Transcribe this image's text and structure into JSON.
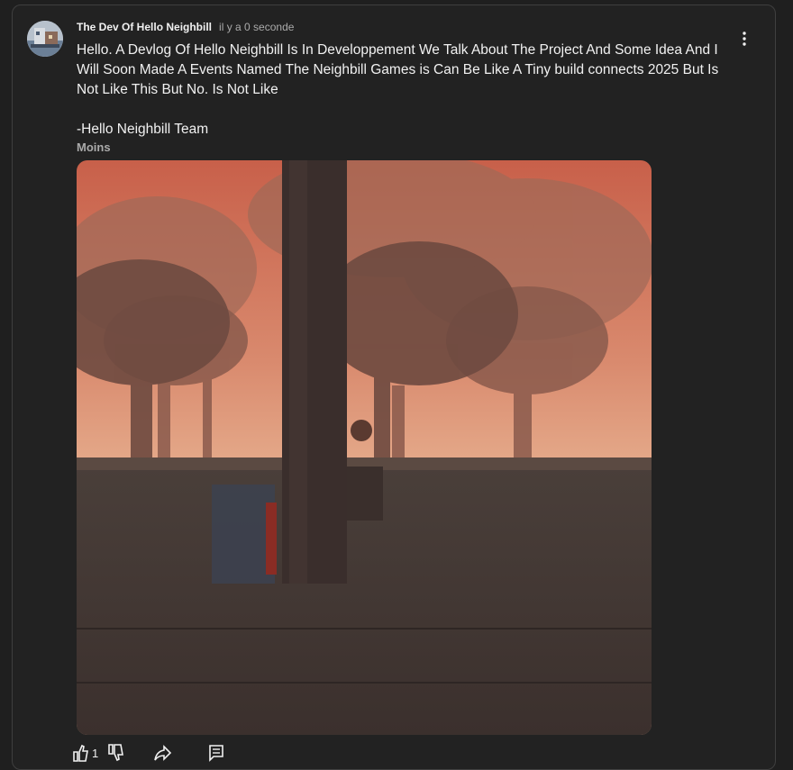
{
  "post": {
    "channel_name": "The Dev Of Hello Neighbill",
    "timestamp": "il y a 0 seconde",
    "body": "Hello. A Devlog Of Hello Neighbill Is In Developpement We Talk About The Project And Some Idea And I Will Soon Made A Events Named The Neighbill Games is Can Be Like A Tiny build connects 2025 But Is Not Like This But No. Is Not Like",
    "signature": "-Hello Neighbill Team",
    "less_label": "Moins",
    "like_count": "1"
  },
  "icons": {
    "avatar": "avatar",
    "menu": "more-vert-icon",
    "like": "thumb-up-icon",
    "dislike": "thumb-down-icon",
    "share": "share-icon",
    "comments": "comment-icon"
  },
  "colors": {
    "background": "#1f1f1f",
    "card_border": "#3f3f3f",
    "text_primary": "#f1f1f1",
    "text_secondary": "#aaaaaa"
  }
}
